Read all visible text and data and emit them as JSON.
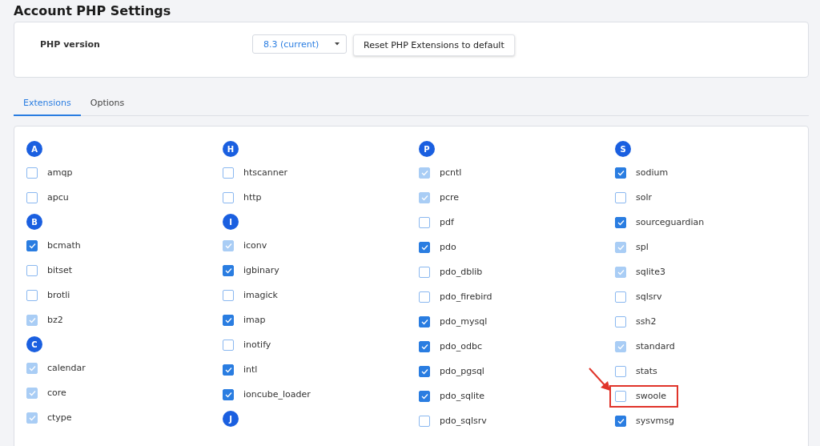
{
  "page_title": "Account PHP Settings",
  "php_version": {
    "label": "PHP version",
    "value": "8.3 (current)",
    "reset_button": "Reset PHP Extensions to default"
  },
  "tabs": [
    {
      "label": "Extensions",
      "selected": true
    },
    {
      "label": "Options",
      "selected": false
    }
  ],
  "columns": [
    {
      "groups": [
        {
          "letter": "A",
          "items": [
            {
              "name": "amqp",
              "checked": false,
              "disabled": false
            },
            {
              "name": "apcu",
              "checked": false,
              "disabled": false
            }
          ]
        },
        {
          "letter": "B",
          "items": [
            {
              "name": "bcmath",
              "checked": true,
              "disabled": false
            },
            {
              "name": "bitset",
              "checked": false,
              "disabled": false
            },
            {
              "name": "brotli",
              "checked": false,
              "disabled": false
            },
            {
              "name": "bz2",
              "checked": true,
              "disabled": true
            }
          ]
        },
        {
          "letter": "C",
          "items": [
            {
              "name": "calendar",
              "checked": true,
              "disabled": true
            },
            {
              "name": "core",
              "checked": true,
              "disabled": true
            },
            {
              "name": "ctype",
              "checked": true,
              "disabled": true
            }
          ]
        }
      ]
    },
    {
      "groups": [
        {
          "letter": "H",
          "items": [
            {
              "name": "htscanner",
              "checked": false,
              "disabled": false
            },
            {
              "name": "http",
              "checked": false,
              "disabled": false
            }
          ]
        },
        {
          "letter": "I",
          "items": [
            {
              "name": "iconv",
              "checked": true,
              "disabled": true
            },
            {
              "name": "igbinary",
              "checked": true,
              "disabled": false
            },
            {
              "name": "imagick",
              "checked": false,
              "disabled": false
            },
            {
              "name": "imap",
              "checked": true,
              "disabled": false
            },
            {
              "name": "inotify",
              "checked": false,
              "disabled": false
            },
            {
              "name": "intl",
              "checked": true,
              "disabled": false
            },
            {
              "name": "ioncube_loader",
              "checked": true,
              "disabled": false
            }
          ]
        },
        {
          "letter": "J"
        }
      ]
    },
    {
      "groups": [
        {
          "letter": "P",
          "items": [
            {
              "name": "pcntl",
              "checked": true,
              "disabled": true
            },
            {
              "name": "pcre",
              "checked": true,
              "disabled": true
            },
            {
              "name": "pdf",
              "checked": false,
              "disabled": false
            },
            {
              "name": "pdo",
              "checked": true,
              "disabled": false
            },
            {
              "name": "pdo_dblib",
              "checked": false,
              "disabled": false
            },
            {
              "name": "pdo_firebird",
              "checked": false,
              "disabled": false
            },
            {
              "name": "pdo_mysql",
              "checked": true,
              "disabled": false
            },
            {
              "name": "pdo_odbc",
              "checked": true,
              "disabled": false
            },
            {
              "name": "pdo_pgsql",
              "checked": true,
              "disabled": false
            },
            {
              "name": "pdo_sqlite",
              "checked": true,
              "disabled": false
            },
            {
              "name": "pdo_sqlsrv",
              "checked": false,
              "disabled": false
            }
          ]
        }
      ]
    },
    {
      "groups": [
        {
          "letter": "S",
          "items": [
            {
              "name": "sodium",
              "checked": true,
              "disabled": false
            },
            {
              "name": "solr",
              "checked": false,
              "disabled": false
            },
            {
              "name": "sourceguardian",
              "checked": true,
              "disabled": false
            },
            {
              "name": "spl",
              "checked": true,
              "disabled": true
            },
            {
              "name": "sqlite3",
              "checked": true,
              "disabled": true
            },
            {
              "name": "sqlsrv",
              "checked": false,
              "disabled": false
            },
            {
              "name": "ssh2",
              "checked": false,
              "disabled": false
            },
            {
              "name": "standard",
              "checked": true,
              "disabled": true
            },
            {
              "name": "stats",
              "checked": false,
              "disabled": false
            },
            {
              "name": "swoole",
              "checked": false,
              "disabled": false,
              "highlighted": true
            },
            {
              "name": "sysvmsg",
              "checked": true,
              "disabled": false
            }
          ]
        }
      ]
    }
  ]
}
